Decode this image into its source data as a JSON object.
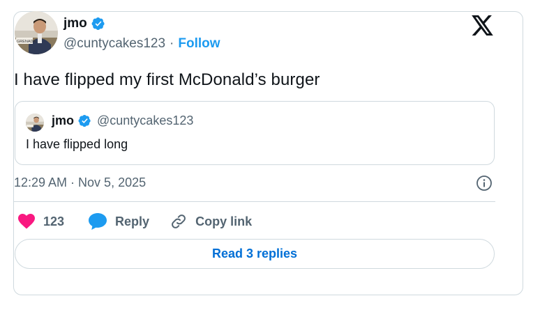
{
  "tweet": {
    "author_name": "jmo",
    "author_handle": "@cuntycakes123",
    "separator": "·",
    "follow_label": "Follow",
    "text": "I have flipped my first McDonald’s burger",
    "timestamp": "12:29 AM · Nov 5, 2025",
    "avatar_sign_text": "GRENADA"
  },
  "quote": {
    "author_name": "jmo",
    "author_handle": "@cuntycakes123",
    "text": "I have flipped long"
  },
  "actions": {
    "like_count": "123",
    "reply_label": "Reply",
    "copy_link_label": "Copy link",
    "read_replies_label": "Read 3 replies"
  },
  "icons": {
    "brand": "x-logo-icon",
    "verified": "verified-badge-icon",
    "info": "info-icon",
    "like": "heart-icon",
    "reply": "speech-bubble-icon",
    "copy": "link-icon"
  },
  "colors": {
    "accent": "#1d9bf0",
    "link": "#006fd6",
    "heart": "#f91880",
    "muted": "#536471",
    "border": "#cfd9de"
  }
}
